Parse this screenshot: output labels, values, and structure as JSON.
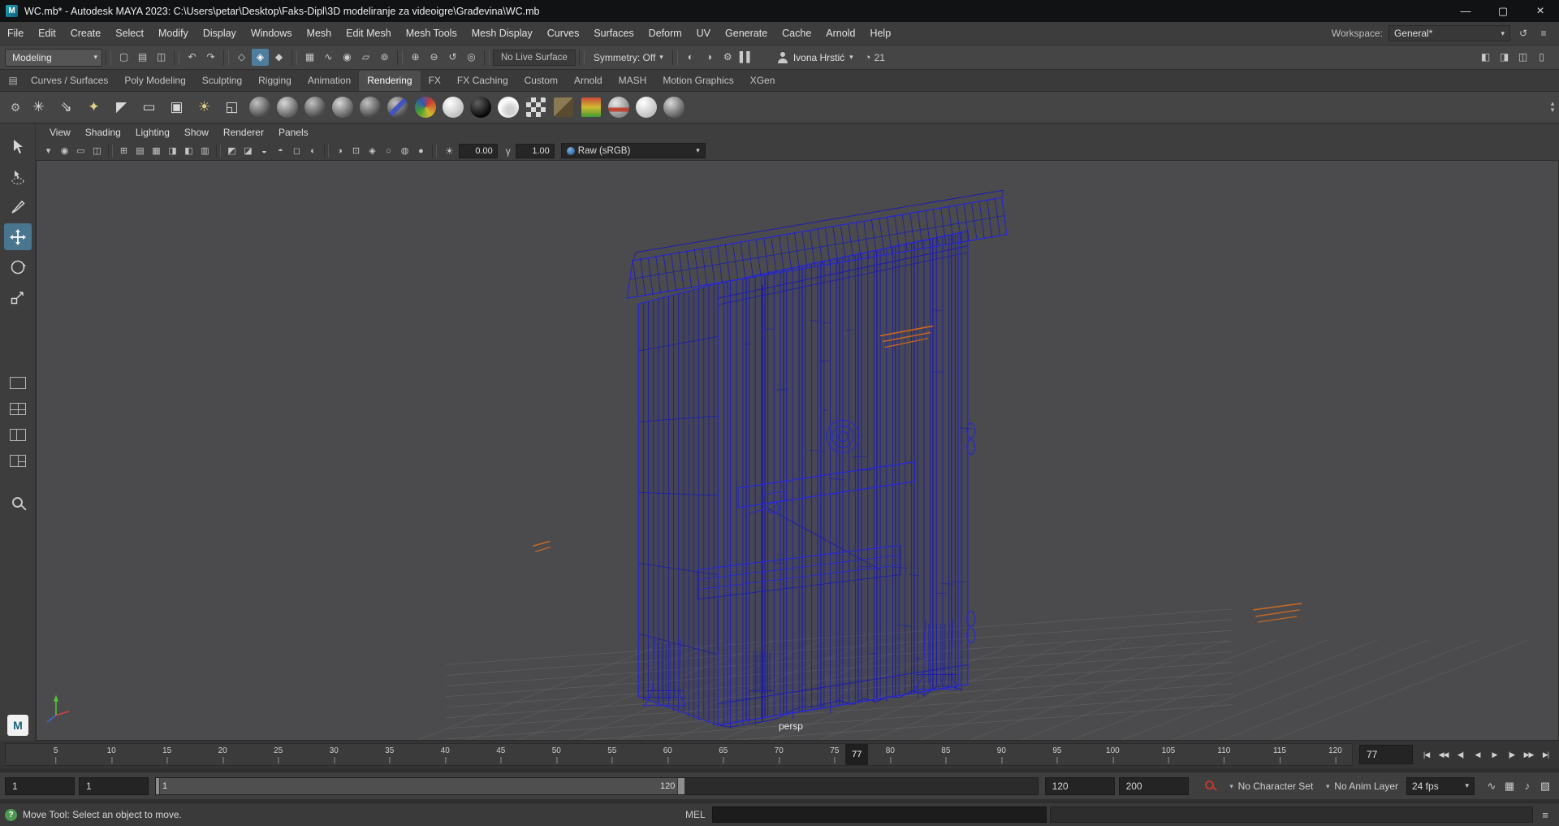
{
  "title_bar": {
    "title": "WC.mb* - Autodesk MAYA 2023: C:\\Users\\petar\\Desktop\\Faks-Dipl\\3D modeliranje za videoigre\\Građevina\\WC.mb",
    "window_buttons": {
      "minimize": "—",
      "maximize": "▢",
      "close": "×"
    }
  },
  "menu_bar": {
    "items": [
      "File",
      "Edit",
      "Create",
      "Select",
      "Modify",
      "Display",
      "Windows",
      "Mesh",
      "Edit Mesh",
      "Mesh Tools",
      "Mesh Display",
      "Curves",
      "Surfaces",
      "Deform",
      "UV",
      "Generate",
      "Cache",
      "Arnold",
      "Help"
    ],
    "workspace_label": "Workspace:",
    "workspace_value": "General*"
  },
  "status_line": {
    "mode_dropdown": "Modeling",
    "groups": [
      {
        "name": "file",
        "icons": [
          {
            "name": "new-scene-icon",
            "glyph": "▢"
          },
          {
            "name": "open-scene-icon",
            "glyph": "▤"
          },
          {
            "name": "save-scene-icon",
            "glyph": "◫"
          }
        ]
      },
      {
        "name": "history",
        "icons": [
          {
            "name": "undo-icon",
            "glyph": "↶"
          },
          {
            "name": "redo-icon",
            "glyph": "↷"
          }
        ]
      },
      {
        "name": "selection-mask",
        "icons": [
          {
            "name": "select-hierarchy-icon",
            "glyph": "◇"
          },
          {
            "name": "select-object-icon",
            "glyph": "◈",
            "active": true
          },
          {
            "name": "select-component-icon",
            "glyph": "◆"
          }
        ]
      },
      {
        "name": "snap",
        "icons": [
          {
            "name": "snap-grid-icon",
            "glyph": "▦"
          },
          {
            "name": "snap-curve-icon",
            "glyph": "∿"
          },
          {
            "name": "snap-point-icon",
            "glyph": "◉"
          },
          {
            "name": "snap-plane-icon",
            "glyph": "▱"
          },
          {
            "name": "snap-view-icon",
            "glyph": "⊚"
          }
        ]
      },
      {
        "name": "inputs",
        "icons": [
          {
            "name": "input-connections-icon",
            "glyph": "⊕"
          },
          {
            "name": "output-connections-icon",
            "glyph": "⊖"
          },
          {
            "name": "construction-history-icon",
            "glyph": "↺"
          },
          {
            "name": "highlight-selection-icon",
            "glyph": "◎"
          }
        ]
      }
    ],
    "live_surface": "No Live Surface",
    "symmetry": "Symmetry: Off",
    "render_icons": [
      {
        "name": "render-frame-icon",
        "glyph": "◐"
      },
      {
        "name": "ipr-render-icon",
        "glyph": "◑"
      },
      {
        "name": "render-settings-icon",
        "glyph": "⚙"
      },
      {
        "name": "pause-icon",
        "glyph": "▌▌"
      }
    ],
    "user_name": "Ivona Hrstić",
    "frame_badge": "21",
    "right_icons": [
      {
        "name": "modeling-toolkit-toggle-icon",
        "glyph": "◧"
      },
      {
        "name": "attribute-editor-toggle-icon",
        "glyph": "◨"
      },
      {
        "name": "tool-settings-toggle-icon",
        "glyph": "◫"
      },
      {
        "name": "channel-box-toggle-icon",
        "glyph": "▯"
      }
    ]
  },
  "shelf": {
    "tabs": [
      "Curves / Surfaces",
      "Poly Modeling",
      "Sculpting",
      "Rigging",
      "Animation",
      "Rendering",
      "FX",
      "FX Caching",
      "Custom",
      "Arnold",
      "MASH",
      "Motion Graphics",
      "XGen"
    ],
    "active_tab": "Rendering",
    "icons": [
      {
        "name": "ambient-light-icon",
        "kind": "glyph",
        "glyph": "✳",
        "color": "#d8d8d8"
      },
      {
        "name": "directional-light-icon",
        "kind": "glyph",
        "glyph": "⇘",
        "color": "#d8d8d8"
      },
      {
        "name": "point-light-icon",
        "kind": "glyph",
        "glyph": "✦",
        "color": "#e0d284"
      },
      {
        "name": "spot-light-icon",
        "kind": "glyph",
        "glyph": "◤",
        "color": "#d8d8d8"
      },
      {
        "name": "area-light-icon",
        "kind": "glyph",
        "glyph": "▭",
        "color": "#d8d8d8"
      },
      {
        "name": "volume-light-icon",
        "kind": "glyph",
        "glyph": "▣",
        "color": "#d8d8d8"
      },
      {
        "name": "light-editor-icon",
        "kind": "glyph",
        "glyph": "☀",
        "color": "#e0d284"
      },
      {
        "name": "shadow-toggle-icon",
        "kind": "glyph",
        "glyph": "◱",
        "color": "#d8d8d8"
      },
      {
        "name": "standard-surface-icon",
        "kind": "sphere",
        "variant": "gray"
      },
      {
        "name": "blinn-material-icon",
        "kind": "sphere",
        "variant": "gray2"
      },
      {
        "name": "lambert-material-icon",
        "kind": "sphere",
        "variant": "gray"
      },
      {
        "name": "phong-material-icon",
        "kind": "sphere",
        "variant": "gray2"
      },
      {
        "name": "phong-e-material-icon",
        "kind": "sphere",
        "variant": "gray"
      },
      {
        "name": "anisotropic-material-icon",
        "kind": "sphere",
        "variant": "stripe"
      },
      {
        "name": "ramp-shader-icon",
        "kind": "sphere",
        "variant": "rgb"
      },
      {
        "name": "surface-shader-icon",
        "kind": "sphere",
        "variant": "white"
      },
      {
        "name": "black-hole-shader-icon",
        "kind": "sphere",
        "variant": "black"
      },
      {
        "name": "use-background-icon",
        "kind": "sphere",
        "variant": "white2"
      },
      {
        "name": "checker-texture-icon",
        "kind": "tex",
        "variant": "checker"
      },
      {
        "name": "file-texture-icon",
        "kind": "tex",
        "variant": "file"
      },
      {
        "name": "ramp-texture-icon",
        "kind": "tex",
        "variant": "ramp"
      },
      {
        "name": "shaded-red-band-icon",
        "kind": "sphere",
        "variant": "red"
      },
      {
        "name": "toon-shader-icon",
        "kind": "sphere",
        "variant": "white"
      },
      {
        "name": "gray-material-icon",
        "kind": "sphere",
        "variant": "gray2"
      }
    ]
  },
  "toolbox": {
    "tools": [
      "select",
      "lasso",
      "paint-select",
      "move",
      "rotate",
      "scale"
    ],
    "active_tool": "move"
  },
  "panel": {
    "menus": [
      "View",
      "Shading",
      "Lighting",
      "Show",
      "Renderer",
      "Panels"
    ],
    "toolbar_icons": [
      "▾",
      "◉",
      "▭",
      "◫",
      "⊞",
      "▤",
      "▦",
      "◨",
      "◧",
      "▥",
      "◩",
      "◪",
      "◒",
      "◓",
      "◻",
      "◐",
      "◑",
      "⊡",
      "◈",
      "○",
      "◍",
      "●"
    ],
    "exposure_icon": "☀",
    "exposure": "0.00",
    "gamma_icon": "γ",
    "gamma": "1.00",
    "view_transform": "Raw (sRGB)"
  },
  "viewport": {
    "camera_label": "persp",
    "colors": {
      "background": "#4b4b4d",
      "wireframe": "#1c1caf",
      "wireframe_bright": "#2a2ac8",
      "selected": "#cf6a1e",
      "grid": "#6d6d6d"
    }
  },
  "time_slider": {
    "tick_labels": [
      "5",
      "10",
      "15",
      "20",
      "25",
      "30",
      "35",
      "40",
      "45",
      "50",
      "55",
      "60",
      "65",
      "70",
      "75",
      "80",
      "85",
      "90",
      "95",
      "100",
      "105",
      "110",
      "115",
      "120"
    ],
    "current_frame": "77",
    "transport": [
      {
        "name": "go-to-start-button",
        "glyph": "|◀"
      },
      {
        "name": "step-back-key-button",
        "glyph": "◀◀"
      },
      {
        "name": "step-back-frame-button",
        "glyph": "◀|"
      },
      {
        "name": "play-backwards-button",
        "glyph": "◀"
      },
      {
        "name": "play-forwards-button",
        "glyph": "▶"
      },
      {
        "name": "step-forward-frame-button",
        "glyph": "|▶"
      },
      {
        "name": "step-forward-key-button",
        "glyph": "▶▶"
      },
      {
        "name": "go-to-end-button",
        "glyph": "▶|"
      }
    ]
  },
  "range_slider": {
    "animation_start": "1",
    "playback_start": "1",
    "bar_start_label": "1",
    "bar_end_label": "120",
    "playback_end": "120",
    "animation_end": "200",
    "character_set": "No Character Set",
    "anim_layer": "No Anim Layer",
    "fps": "24 fps",
    "right_icons": [
      {
        "name": "playback-curves-icon",
        "glyph": "∿"
      },
      {
        "name": "grease-pencil-icon",
        "glyph": "▦"
      },
      {
        "name": "mute-audio-icon",
        "glyph": "♪"
      },
      {
        "name": "animation-prefs-icon",
        "glyph": "▧"
      }
    ]
  },
  "command_line": {
    "mel_label": "MEL"
  },
  "help_line": {
    "text": "Move Tool: Select an object to move."
  }
}
